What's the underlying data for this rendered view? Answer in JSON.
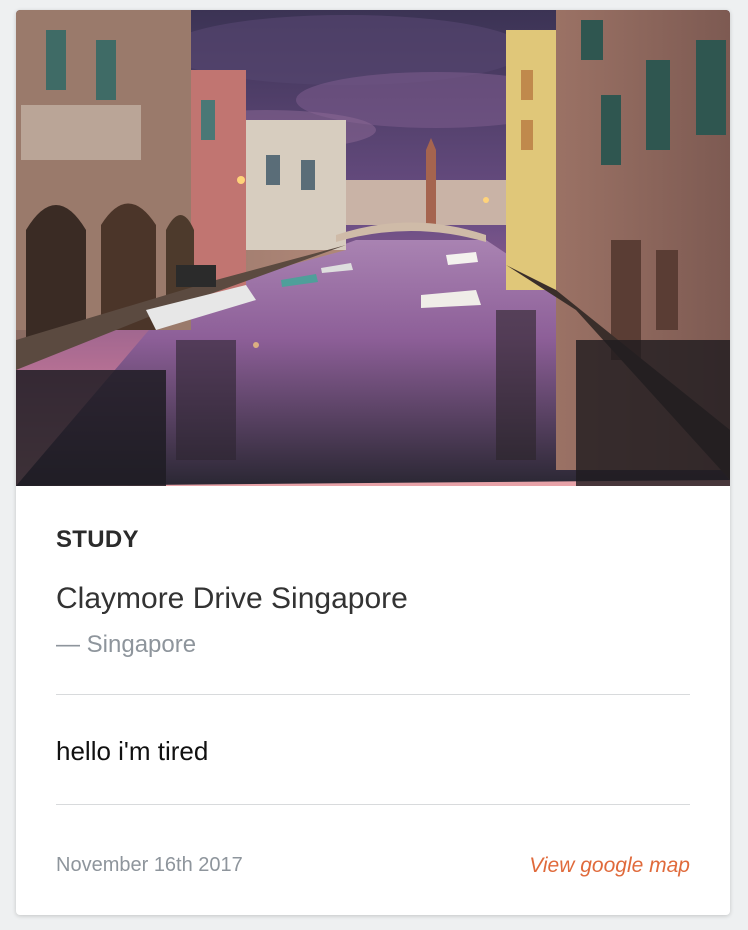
{
  "card": {
    "image_subject": "",
    "category": "STUDY",
    "title": "Claymore Drive Singapore",
    "subtitle": "— Singapore",
    "note": "hello i'm tired",
    "date": "November 16th 2017",
    "map_link": "View google map"
  },
  "colors": {
    "accent": "#e06a3b",
    "muted_text": "#8e959c",
    "divider": "#d8dadc"
  }
}
